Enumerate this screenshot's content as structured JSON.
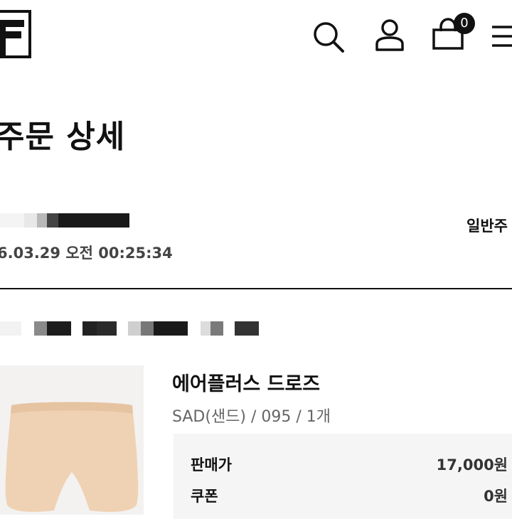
{
  "header": {
    "logo": "FILA",
    "cart_count": "0",
    "icons": [
      "logo-icon",
      "search-icon",
      "user-icon",
      "cart-icon",
      "menu-icon"
    ]
  },
  "page": {
    "title": "주문 상세"
  },
  "order": {
    "date": "6.03.29 오전 00:25:34",
    "type": "일반주"
  },
  "product": {
    "name": "에어플러스 드로즈",
    "option": "SAD(샌드) / 095 / 1개",
    "price_label": "판매가",
    "price_value": "17,000원",
    "coupon_label": "쿠폰",
    "coupon_value": "0원"
  },
  "colors": {
    "text": "#111111",
    "muted": "#666666",
    "panel": "#f5f5f5",
    "product_fill": "#efd2b3"
  }
}
